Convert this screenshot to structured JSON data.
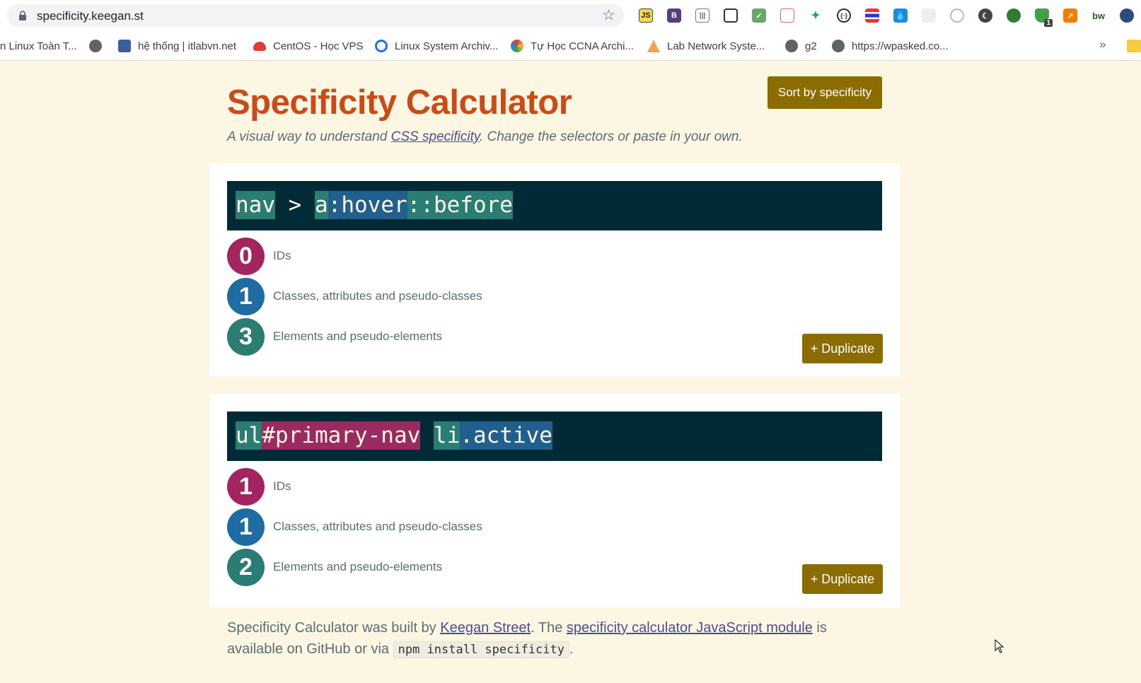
{
  "browser": {
    "url": "specificity.keegan.st",
    "extensions": [
      "js-icon",
      "bootstrap-icon",
      "barcode-icon",
      "screenshot-icon",
      "checklist-icon",
      "calendar-icon",
      "bird-icon",
      "code-brackets-icon",
      "lines-icon",
      "drop-icon",
      "blank-icon",
      "record-icon",
      "moon-icon",
      "globe-icon",
      "shield-icon",
      "chart-icon",
      "bw-icon",
      "profile-icon"
    ],
    "extension_badge": "1",
    "bookmarks": [
      {
        "label": "n Linux Toàn T...",
        "icon": "blank-icon"
      },
      {
        "label": "",
        "icon": "globe-icon"
      },
      {
        "label": "hệ thống | itlabvn.net",
        "icon": "monitor-icon"
      },
      {
        "label": "CentOS - Học VPS",
        "icon": "cloud-icon"
      },
      {
        "label": "Linux System Archiv...",
        "icon": "search-icon"
      },
      {
        "label": "Tự Học CCNA Archi...",
        "icon": "leaf-icon"
      },
      {
        "label": "Lab Network Syste...",
        "icon": "triangle-icon"
      },
      {
        "label": "g2",
        "icon": "globe-icon"
      },
      {
        "label": "https://wpasked.co...",
        "icon": "globe-icon"
      }
    ],
    "more_label": "»"
  },
  "header": {
    "title": "Specificity Calculator",
    "subtitle_before": "A visual way to understand ",
    "subtitle_link": "CSS specificity",
    "subtitle_after": ". Change the selectors or paste in your own.",
    "sort_label": "Sort by specificity"
  },
  "cards": [
    {
      "selector_parts": [
        {
          "text": "nav",
          "kind": "element"
        },
        {
          "text": " > ",
          "kind": "plain"
        },
        {
          "text": "a",
          "kind": "element"
        },
        {
          "text": ":hover",
          "kind": "class"
        },
        {
          "text": "::before",
          "kind": "element"
        }
      ],
      "ids": "0",
      "classes": "1",
      "elements": "3",
      "ids_label": "IDs",
      "classes_label": "Classes, attributes and pseudo-classes",
      "elements_label": "Elements and pseudo-elements",
      "duplicate_label": "+ Duplicate"
    },
    {
      "selector_parts": [
        {
          "text": "ul",
          "kind": "element"
        },
        {
          "text": "#primary-nav",
          "kind": "id"
        },
        {
          "text": " ",
          "kind": "plain"
        },
        {
          "text": "li",
          "kind": "element"
        },
        {
          "text": ".active",
          "kind": "class"
        }
      ],
      "ids": "1",
      "classes": "1",
      "elements": "2",
      "ids_label": "IDs",
      "classes_label": "Classes, attributes and pseudo-classes",
      "elements_label": "Elements and pseudo-elements",
      "duplicate_label": "+ Duplicate"
    }
  ],
  "footer": {
    "text1": "Specificity Calculator was built by ",
    "link1": "Keegan Street",
    "text2": ". The ",
    "link2": "specificity calculator JavaScript module",
    "text3": " is available on GitHub or via ",
    "code": "npm install specificity",
    "text4": "."
  },
  "colors": {
    "accent": "#cb4b16",
    "button": "#8b6c00",
    "id": "#a3245f",
    "class": "#1f6ca3",
    "element": "#2b7c72",
    "selector_bg": "#002b36",
    "page_bg": "#fdf6e3"
  }
}
